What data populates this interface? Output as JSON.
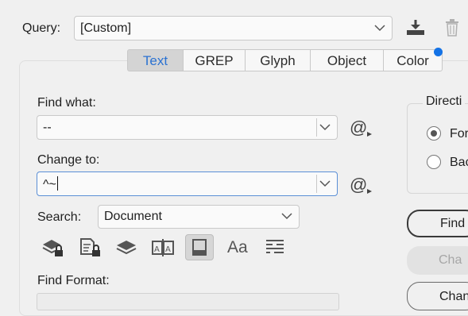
{
  "query": {
    "label": "Query:",
    "value": "[Custom]"
  },
  "tabs": [
    {
      "label": "Text",
      "active": true
    },
    {
      "label": "GREP",
      "active": false
    },
    {
      "label": "Glyph",
      "active": false
    },
    {
      "label": "Object",
      "active": false
    },
    {
      "label": "Color",
      "active": false
    }
  ],
  "find_what": {
    "label": "Find what:",
    "value": "--"
  },
  "change_to": {
    "label": "Change to:",
    "value": "^~"
  },
  "special_char_symbol": "@",
  "search": {
    "label": "Search:",
    "value": "Document"
  },
  "find_format": {
    "label": "Find Format:"
  },
  "direction": {
    "title": "Directi",
    "forward": "For",
    "backward": "Bac"
  },
  "buttons": {
    "find": "Find",
    "change": "Cha",
    "change_all": "Chan"
  },
  "icons": {
    "save_query": "download-icon",
    "delete_query": "trash-icon",
    "option_icons": [
      "locked-layers-icon",
      "locked-stories-icon",
      "hidden-layers-icon",
      "master-pages-icon",
      "footnotes-icon",
      "case-sensitive-icon",
      "whole-word-icon"
    ]
  },
  "colors": {
    "accent": "#2b72d2",
    "notification_dot": "#1473e6"
  }
}
